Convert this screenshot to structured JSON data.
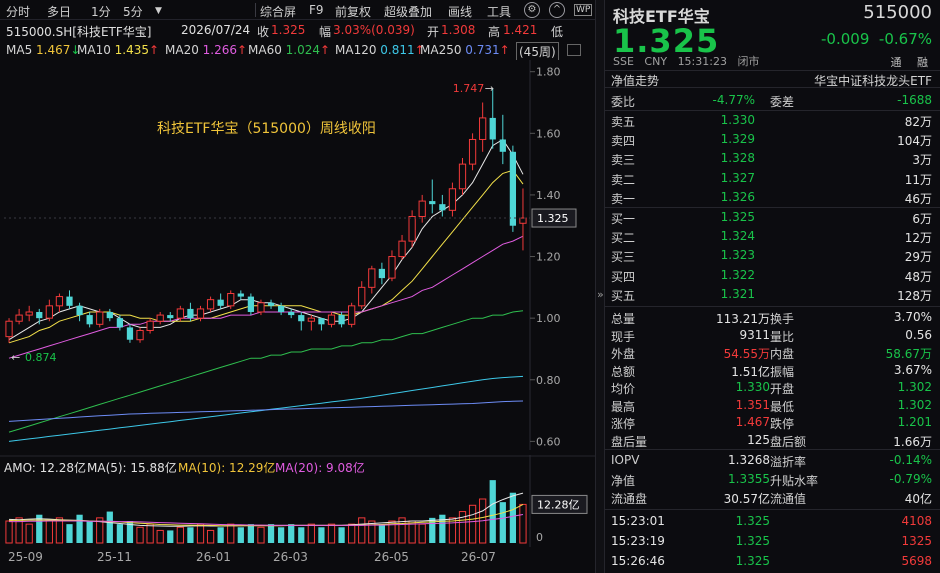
{
  "toolbar": {
    "left_items": [
      "分时",
      "多日",
      "1分",
      "5分"
    ],
    "right_items": [
      "综合屏",
      "F9",
      "前复权",
      "超级叠加",
      "画线",
      "工具"
    ],
    "icons": [
      "gear-icon",
      "collapse-icon",
      "window-icon"
    ]
  },
  "info": {
    "symbol": "515000.SH[科技ETF华宝]",
    "date": "2026/07/24",
    "close_label": "收",
    "close": "1.325",
    "amp_label": "幅",
    "amp": "3.03%(0.039)",
    "open_label": "开",
    "open": "1.308",
    "high_label": "高",
    "high": "1.421",
    "low_label": "低"
  },
  "ma_line": {
    "items": [
      {
        "label": "MA5",
        "value": "1.467",
        "arrow": "↓",
        "color": "#e8e8e8"
      },
      {
        "label": "MA10",
        "value": "1.435",
        "arrow": "↑",
        "color": "#f3e14a"
      },
      {
        "label": "MA20",
        "value": "1.266",
        "arrow": "↑",
        "color": "#e05ce0"
      },
      {
        "label": "MA60",
        "value": "1.024",
        "arrow": "↑",
        "color": "#2fbf4f"
      },
      {
        "label": "MA120",
        "value": "0.811",
        "arrow": "↑",
        "color": "#3dc8e8"
      },
      {
        "label": "MA250",
        "value": "0.731",
        "arrow": "↑",
        "color": "#6d8cf5"
      }
    ],
    "period": "(45周)"
  },
  "annotation": "科技ETF华宝（515000）周线收阳",
  "chart_data": {
    "type": "candlestick",
    "period": "weekly",
    "y_ticks": [
      "1.80",
      "1.60",
      "1.40",
      "1.20",
      "1.00",
      "0.80",
      "0.60"
    ],
    "ylim": [
      0.585,
      1.812
    ],
    "current_price_tag": "1.325",
    "high_marker": "1.747",
    "low_marker": "0.874",
    "x_labels": [
      "25-09",
      "25-11",
      "26-01",
      "26-03",
      "26-05",
      "26-07"
    ],
    "candles": [
      [
        0.94,
        0.99,
        0.92,
        1.0
      ],
      [
        0.99,
        1.01,
        0.98,
        1.03
      ],
      [
        1.01,
        1.02,
        0.99,
        1.04
      ],
      [
        1.02,
        1.0,
        0.98,
        1.03
      ],
      [
        1.0,
        1.04,
        0.99,
        1.06
      ],
      [
        1.04,
        1.07,
        1.02,
        1.08
      ],
      [
        1.07,
        1.04,
        1.03,
        1.09
      ],
      [
        1.04,
        1.01,
        0.99,
        1.05
      ],
      [
        1.01,
        0.98,
        0.97,
        1.02
      ],
      [
        0.98,
        1.02,
        0.97,
        1.03
      ],
      [
        1.02,
        1.0,
        0.99,
        1.03
      ],
      [
        1.0,
        0.97,
        0.96,
        1.01
      ],
      [
        0.97,
        0.93,
        0.92,
        0.98
      ],
      [
        0.93,
        0.96,
        0.92,
        0.97
      ],
      [
        0.96,
        0.99,
        0.95,
        1.0
      ],
      [
        0.99,
        1.01,
        0.98,
        1.02
      ],
      [
        1.01,
        1.0,
        0.99,
        1.02
      ],
      [
        1.0,
        1.03,
        0.99,
        1.04
      ],
      [
        1.03,
        1.0,
        0.99,
        1.05
      ],
      [
        1.0,
        1.03,
        0.99,
        1.04
      ],
      [
        1.03,
        1.06,
        1.02,
        1.07
      ],
      [
        1.06,
        1.04,
        1.03,
        1.08
      ],
      [
        1.04,
        1.08,
        1.03,
        1.09
      ],
      [
        1.08,
        1.07,
        1.06,
        1.09
      ],
      [
        1.07,
        1.02,
        1.01,
        1.08
      ],
      [
        1.02,
        1.05,
        1.01,
        1.06
      ],
      [
        1.05,
        1.04,
        1.03,
        1.06
      ],
      [
        1.04,
        1.02,
        1.01,
        1.05
      ],
      [
        1.02,
        1.01,
        1.0,
        1.03
      ],
      [
        1.01,
        0.99,
        0.96,
        1.02
      ],
      [
        0.99,
        1.0,
        0.96,
        1.01
      ],
      [
        1.0,
        0.98,
        0.96,
        1.0
      ],
      [
        0.98,
        1.01,
        0.97,
        1.02
      ],
      [
        1.01,
        0.98,
        0.97,
        1.02
      ],
      [
        0.98,
        1.04,
        0.97,
        1.05
      ],
      [
        1.04,
        1.1,
        1.03,
        1.12
      ],
      [
        1.1,
        1.16,
        1.08,
        1.17
      ],
      [
        1.16,
        1.13,
        1.11,
        1.18
      ],
      [
        1.13,
        1.2,
        1.12,
        1.22
      ],
      [
        1.2,
        1.25,
        1.19,
        1.27
      ],
      [
        1.25,
        1.33,
        1.23,
        1.35
      ],
      [
        1.33,
        1.38,
        1.31,
        1.4
      ],
      [
        1.38,
        1.37,
        1.34,
        1.45
      ],
      [
        1.37,
        1.35,
        1.33,
        1.4
      ],
      [
        1.35,
        1.42,
        1.33,
        1.44
      ],
      [
        1.42,
        1.5,
        1.4,
        1.52
      ],
      [
        1.5,
        1.58,
        1.48,
        1.6
      ],
      [
        1.58,
        1.65,
        1.54,
        1.7
      ],
      [
        1.65,
        1.58,
        1.55,
        1.747
      ],
      [
        1.58,
        1.54,
        1.5,
        1.66
      ],
      [
        1.54,
        1.3,
        1.28,
        1.56
      ],
      [
        1.308,
        1.325,
        1.22,
        1.421
      ]
    ],
    "ma": {
      "MA5": [
        0.93,
        0.95,
        0.97,
        0.99,
        1.0,
        1.02,
        1.03,
        1.04,
        1.03,
        1.02,
        1.02,
        1.0,
        0.98,
        0.97,
        0.97,
        0.97,
        0.98,
        1.0,
        1.01,
        1.01,
        1.02,
        1.03,
        1.04,
        1.06,
        1.06,
        1.05,
        1.05,
        1.04,
        1.03,
        1.02,
        1.01,
        1.0,
        0.99,
        0.99,
        1.0,
        1.02,
        1.06,
        1.1,
        1.14,
        1.19,
        1.23,
        1.29,
        1.33,
        1.35,
        1.37,
        1.4,
        1.44,
        1.5,
        1.56,
        1.58,
        1.53,
        1.467
      ],
      "MA10": [
        0.92,
        0.93,
        0.94,
        0.96,
        0.97,
        0.99,
        1.0,
        1.01,
        1.02,
        1.02,
        1.02,
        1.01,
        1.01,
        1.0,
        1.0,
        0.99,
        0.99,
        0.99,
        0.99,
        1.0,
        1.0,
        1.01,
        1.02,
        1.03,
        1.04,
        1.04,
        1.04,
        1.04,
        1.04,
        1.04,
        1.03,
        1.02,
        1.02,
        1.01,
        1.01,
        1.02,
        1.03,
        1.04,
        1.06,
        1.09,
        1.12,
        1.16,
        1.2,
        1.24,
        1.28,
        1.32,
        1.36,
        1.4,
        1.44,
        1.47,
        1.48,
        1.435
      ],
      "MA20": [
        0.87,
        0.88,
        0.89,
        0.9,
        0.91,
        0.92,
        0.93,
        0.94,
        0.95,
        0.96,
        0.97,
        0.97,
        0.98,
        0.98,
        0.99,
        0.99,
        0.99,
        1.0,
        1.0,
        1.0,
        1.0,
        1.0,
        1.01,
        1.01,
        1.01,
        1.02,
        1.02,
        1.02,
        1.02,
        1.02,
        1.02,
        1.02,
        1.02,
        1.02,
        1.02,
        1.02,
        1.03,
        1.04,
        1.05,
        1.06,
        1.07,
        1.09,
        1.1,
        1.12,
        1.14,
        1.16,
        1.18,
        1.2,
        1.22,
        1.24,
        1.25,
        1.266
      ],
      "MA60": [
        0.63,
        0.64,
        0.65,
        0.66,
        0.67,
        0.68,
        0.69,
        0.7,
        0.71,
        0.72,
        0.73,
        0.74,
        0.75,
        0.76,
        0.77,
        0.78,
        0.79,
        0.8,
        0.81,
        0.82,
        0.83,
        0.84,
        0.85,
        0.86,
        0.87,
        0.87,
        0.88,
        0.88,
        0.89,
        0.89,
        0.9,
        0.9,
        0.9,
        0.91,
        0.91,
        0.92,
        0.92,
        0.93,
        0.93,
        0.94,
        0.95,
        0.95,
        0.96,
        0.97,
        0.98,
        0.99,
        1.0,
        1.0,
        1.01,
        1.01,
        1.02,
        1.024
      ],
      "MA120": [
        0.6,
        0.604,
        0.608,
        0.612,
        0.616,
        0.62,
        0.624,
        0.628,
        0.632,
        0.636,
        0.64,
        0.644,
        0.648,
        0.652,
        0.656,
        0.66,
        0.664,
        0.668,
        0.672,
        0.676,
        0.68,
        0.684,
        0.688,
        0.692,
        0.696,
        0.7,
        0.704,
        0.708,
        0.712,
        0.716,
        0.72,
        0.724,
        0.728,
        0.732,
        0.736,
        0.74,
        0.745,
        0.75,
        0.755,
        0.76,
        0.765,
        0.77,
        0.775,
        0.78,
        0.785,
        0.79,
        0.795,
        0.8,
        0.804,
        0.807,
        0.809,
        0.811
      ],
      "MA250": [
        0.665,
        0.667,
        0.669,
        0.671,
        0.673,
        0.675,
        0.677,
        0.679,
        0.681,
        0.683,
        0.685,
        0.687,
        0.689,
        0.69,
        0.691,
        0.692,
        0.693,
        0.694,
        0.695,
        0.696,
        0.697,
        0.698,
        0.699,
        0.7,
        0.701,
        0.702,
        0.703,
        0.704,
        0.705,
        0.706,
        0.707,
        0.708,
        0.709,
        0.71,
        0.711,
        0.712,
        0.713,
        0.714,
        0.715,
        0.716,
        0.717,
        0.718,
        0.719,
        0.72,
        0.721,
        0.722,
        0.723,
        0.725,
        0.727,
        0.729,
        0.73,
        0.731
      ]
    },
    "volume": {
      "ylim": [
        0,
        21
      ],
      "current_tag": "12.28亿",
      "values": [
        7,
        8,
        6,
        9,
        7,
        8,
        6,
        9,
        7,
        8,
        10,
        6,
        7,
        5,
        6,
        4,
        4,
        5,
        5,
        6,
        4,
        5,
        6,
        5,
        6,
        5,
        6,
        5,
        6,
        5,
        6,
        5,
        6,
        5,
        6,
        8,
        7,
        6,
        7,
        8,
        7,
        6,
        8,
        9,
        8,
        10,
        12,
        14,
        20,
        13,
        16,
        12.28
      ],
      "ma5": [
        7.5,
        7.4,
        7.6,
        7.7,
        7.6,
        7.4,
        7.3,
        7.2,
        7.0,
        6.8,
        6.5,
        6.2,
        5.9,
        5.6,
        5.5,
        5.4,
        5.3,
        5.3,
        5.4,
        5.5,
        5.4,
        5.4,
        5.5,
        5.5,
        5.6,
        5.6,
        5.6,
        5.6,
        5.6,
        5.6,
        5.6,
        5.6,
        5.6,
        5.6,
        5.8,
        6.0,
        6.2,
        6.4,
        6.6,
        6.8,
        7.0,
        7.0,
        7.2,
        7.4,
        7.6,
        8.2,
        9.0,
        10.2,
        12.4,
        13.8,
        15.0,
        15.88
      ],
      "ma10": [
        7.2,
        7.2,
        7.3,
        7.3,
        7.3,
        7.3,
        7.2,
        7.1,
        7.0,
        6.9,
        6.8,
        6.7,
        6.5,
        6.3,
        6.1,
        5.9,
        5.8,
        5.7,
        5.7,
        5.6,
        5.6,
        5.5,
        5.5,
        5.5,
        5.5,
        5.5,
        5.5,
        5.5,
        5.6,
        5.6,
        5.6,
        5.6,
        5.6,
        5.6,
        5.6,
        5.7,
        5.8,
        5.9,
        6.1,
        6.2,
        6.4,
        6.6,
        6.7,
        6.9,
        7.0,
        7.3,
        7.6,
        8.1,
        8.8,
        9.6,
        10.6,
        12.29
      ],
      "ma20": [
        6.8,
        6.8,
        6.9,
        6.9,
        7.0,
        7.0,
        7.0,
        7.0,
        6.9,
        6.9,
        6.9,
        6.8,
        6.8,
        6.7,
        6.6,
        6.5,
        6.4,
        6.3,
        6.2,
        6.1,
        6.0,
        5.9,
        5.8,
        5.8,
        5.7,
        5.7,
        5.6,
        5.6,
        5.6,
        5.6,
        5.6,
        5.6,
        5.6,
        5.6,
        5.6,
        5.6,
        5.7,
        5.7,
        5.8,
        5.9,
        6.0,
        6.1,
        6.2,
        6.3,
        6.4,
        6.6,
        6.8,
        7.1,
        7.5,
        7.9,
        8.5,
        9.08
      ]
    }
  },
  "vol_legend": {
    "amo": "AMO: 12.28亿",
    "ma5": "MA(5): 15.88亿",
    "ma10": "MA(10): 12.29亿",
    "ma20": "MA(20): 9.08亿",
    "zero": "0"
  },
  "splitter_label": "»",
  "quote": {
    "name": "科技ETF华宝",
    "code": "515000",
    "price": "1.325",
    "change": "-0.009",
    "change_pct": "-0.67%",
    "meta": [
      "SSE",
      "CNY",
      "15:31:23",
      "闭市"
    ],
    "flags": [
      "通",
      "融"
    ],
    "header_left": "净值走势",
    "header_right": "华宝中证科技龙头ETF",
    "webi": {
      "label1": "委比",
      "value1": "-4.77%",
      "label2": "委差",
      "value2": "-1688"
    },
    "asks": [
      {
        "label": "卖五",
        "price": "1.330",
        "vol": "82万"
      },
      {
        "label": "卖四",
        "price": "1.329",
        "vol": "104万"
      },
      {
        "label": "卖三",
        "price": "1.328",
        "vol": "3万"
      },
      {
        "label": "卖二",
        "price": "1.327",
        "vol": "11万"
      },
      {
        "label": "卖一",
        "price": "1.326",
        "vol": "46万"
      }
    ],
    "bids": [
      {
        "label": "买一",
        "price": "1.325",
        "vol": "6万"
      },
      {
        "label": "买二",
        "price": "1.324",
        "vol": "12万"
      },
      {
        "label": "买三",
        "price": "1.323",
        "vol": "29万"
      },
      {
        "label": "买四",
        "price": "1.322",
        "vol": "48万"
      },
      {
        "label": "买五",
        "price": "1.321",
        "vol": "128万"
      }
    ],
    "stats": [
      {
        "l1": "总量",
        "v1": "113.21万",
        "c1": "white",
        "l2": "换手",
        "v2": "3.70%",
        "c2": "white"
      },
      {
        "l1": "现手",
        "v1": "9311",
        "c1": "white",
        "l2": "量比",
        "v2": "0.56",
        "c2": "white"
      },
      {
        "l1": "外盘",
        "v1": "54.55万",
        "c1": "red",
        "l2": "内盘",
        "v2": "58.67万",
        "c2": "green"
      },
      {
        "l1": "总额",
        "v1": "1.51亿",
        "c1": "white",
        "l2": "振幅",
        "v2": "3.67%",
        "c2": "white"
      },
      {
        "l1": "均价",
        "v1": "1.330",
        "c1": "green",
        "l2": "开盘",
        "v2": "1.302",
        "c2": "green"
      },
      {
        "l1": "最高",
        "v1": "1.351",
        "c1": "red",
        "l2": "最低",
        "v2": "1.302",
        "c2": "green"
      },
      {
        "l1": "涨停",
        "v1": "1.467",
        "c1": "red",
        "l2": "跌停",
        "v2": "1.201",
        "c2": "green"
      },
      {
        "l1": "盘后量",
        "v1": "125",
        "c1": "white",
        "l2": "盘后额",
        "v2": "1.66万",
        "c2": "white"
      }
    ],
    "iopv": [
      {
        "l1": "IOPV",
        "v1": "1.3268",
        "c1": "white",
        "l2": "溢折率",
        "v2": "-0.14%",
        "c2": "green"
      },
      {
        "l1": "净值",
        "v1": "1.3355",
        "c1": "green",
        "l2": "升贴水率",
        "v2": "-0.79%",
        "c2": "green"
      },
      {
        "l1": "流通盘",
        "v1": "30.57亿",
        "c1": "white",
        "l2": "流通值",
        "v2": "40亿",
        "c2": "white"
      }
    ],
    "ticks": [
      {
        "time": "15:23:01",
        "price": "1.325",
        "vol": "4108"
      },
      {
        "time": "15:23:19",
        "price": "1.325",
        "vol": "1325"
      },
      {
        "time": "15:26:46",
        "price": "1.325",
        "vol": "5698"
      }
    ]
  },
  "colors": {
    "up": "#f23a3a",
    "down": "#19c34a",
    "cyan_bar": "#4fd6d6",
    "accent": "#f0c43a"
  }
}
